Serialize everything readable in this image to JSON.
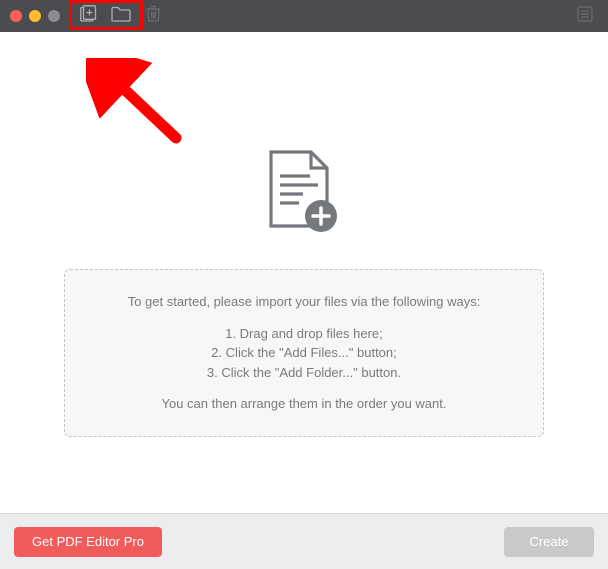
{
  "toolbar": {
    "add_files_icon": "add-files",
    "add_folder_icon": "add-folder",
    "delete_icon": "trash",
    "list_icon": "list"
  },
  "instructions": {
    "intro": "To get started, please import your files via the following ways:",
    "step1": "1. Drag and drop files here;",
    "step2": "2. Click the \"Add Files...\" button;",
    "step3": "3. Click the \"Add Folder...\" button.",
    "outro": "You can then arrange them in the order you want."
  },
  "footer": {
    "upgrade_label": "Get PDF Editor Pro",
    "create_label": "Create"
  },
  "annotation": {
    "arrow_color": "#ff0000"
  }
}
